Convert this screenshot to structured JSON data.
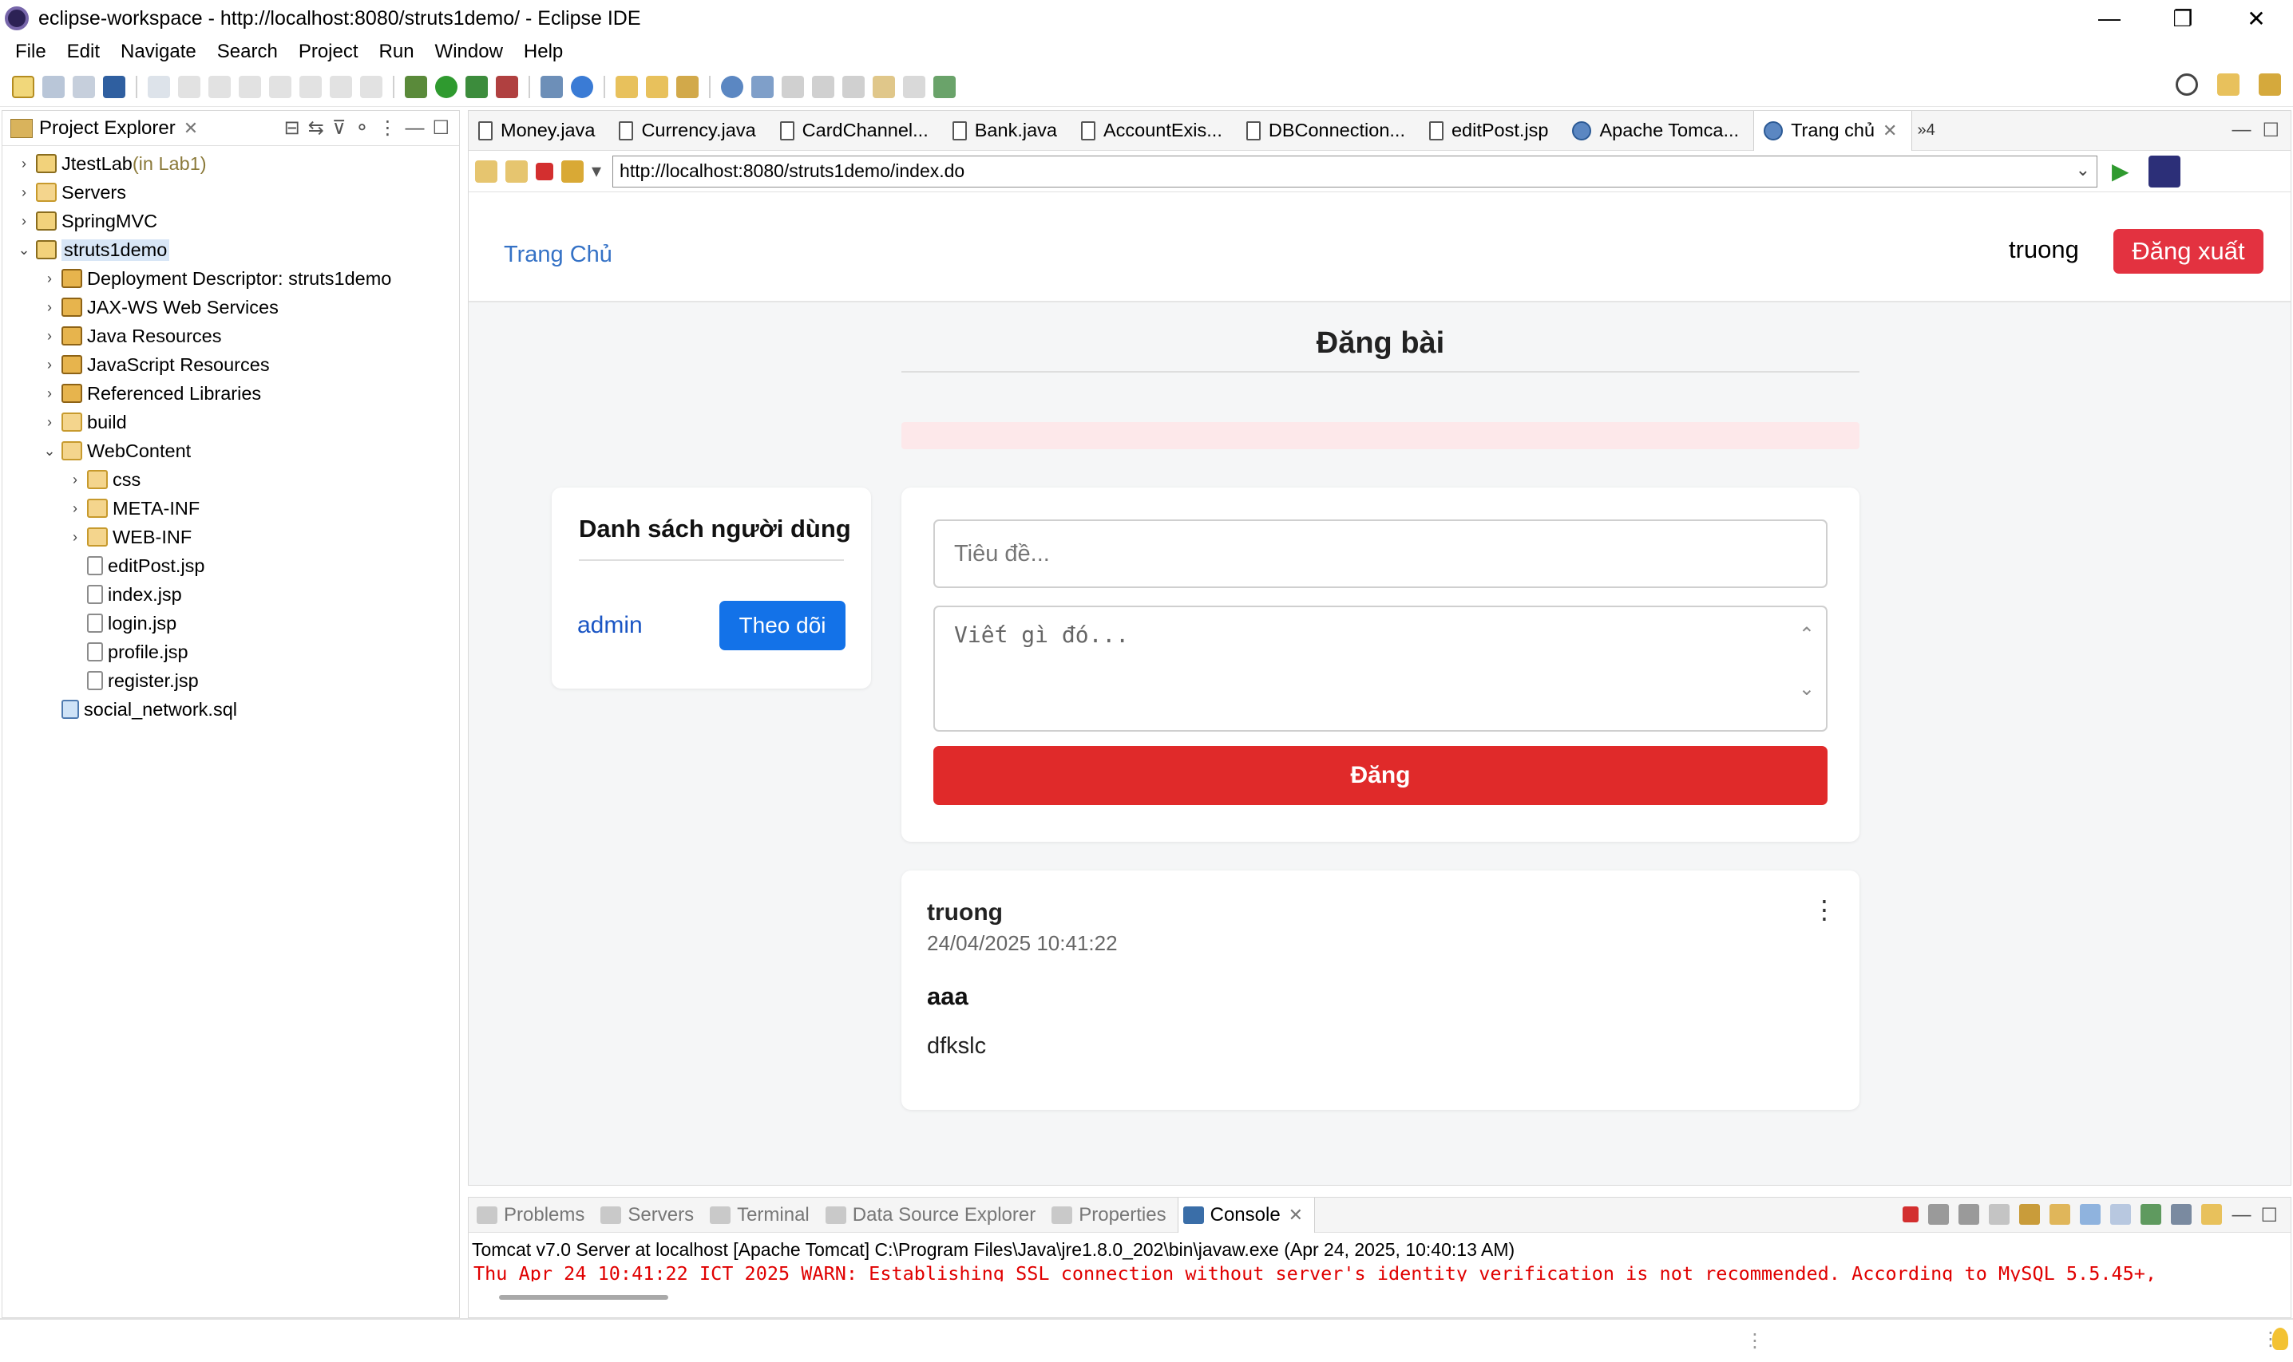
{
  "window": {
    "title": "eclipse-workspace - http://localhost:8080/struts1demo/ - Eclipse IDE",
    "minimize": "—",
    "restore": "❐",
    "close": "✕"
  },
  "menu": [
    "File",
    "Edit",
    "Navigate",
    "Search",
    "Project",
    "Run",
    "Window",
    "Help"
  ],
  "explorer": {
    "title": "Project Explorer",
    "close": "✕",
    "tree": [
      {
        "label": "JtestLab",
        "suffix": " (in Lab1)",
        "indent": 0,
        "twisty": "›",
        "icon": "project"
      },
      {
        "label": "Servers",
        "indent": 0,
        "twisty": "›",
        "icon": "folder"
      },
      {
        "label": "SpringMVC",
        "indent": 0,
        "twisty": "›",
        "icon": "project"
      },
      {
        "label": "struts1demo",
        "indent": 0,
        "twisty": "⌄",
        "icon": "project",
        "selected": true
      },
      {
        "label": "Deployment Descriptor: struts1demo",
        "indent": 1,
        "twisty": "›",
        "icon": "pkg"
      },
      {
        "label": "JAX-WS Web Services",
        "indent": 1,
        "twisty": "›",
        "icon": "pkg"
      },
      {
        "label": "Java Resources",
        "indent": 1,
        "twisty": "›",
        "icon": "pkg"
      },
      {
        "label": "JavaScript Resources",
        "indent": 1,
        "twisty": "›",
        "icon": "pkg"
      },
      {
        "label": "Referenced Libraries",
        "indent": 1,
        "twisty": "›",
        "icon": "pkg"
      },
      {
        "label": "build",
        "indent": 1,
        "twisty": "›",
        "icon": "folder"
      },
      {
        "label": "WebContent",
        "indent": 1,
        "twisty": "⌄",
        "icon": "folder"
      },
      {
        "label": "css",
        "indent": 2,
        "twisty": "›",
        "icon": "folder"
      },
      {
        "label": "META-INF",
        "indent": 2,
        "twisty": "›",
        "icon": "folder"
      },
      {
        "label": "WEB-INF",
        "indent": 2,
        "twisty": "›",
        "icon": "folder"
      },
      {
        "label": "editPost.jsp",
        "indent": 2,
        "twisty": "",
        "icon": "jsp"
      },
      {
        "label": "index.jsp",
        "indent": 2,
        "twisty": "",
        "icon": "jsp"
      },
      {
        "label": "login.jsp",
        "indent": 2,
        "twisty": "",
        "icon": "jsp"
      },
      {
        "label": "profile.jsp",
        "indent": 2,
        "twisty": "",
        "icon": "jsp"
      },
      {
        "label": "register.jsp",
        "indent": 2,
        "twisty": "",
        "icon": "jsp"
      },
      {
        "label": "social_network.sql",
        "indent": 1,
        "twisty": "",
        "icon": "sql"
      }
    ]
  },
  "editor": {
    "tabs": [
      {
        "label": "Money.java",
        "icon": "java"
      },
      {
        "label": "Currency.java",
        "icon": "java"
      },
      {
        "label": "CardChannel...",
        "icon": "java"
      },
      {
        "label": "Bank.java",
        "icon": "java"
      },
      {
        "label": "AccountExis...",
        "icon": "java"
      },
      {
        "label": "DBConnection...",
        "icon": "java"
      },
      {
        "label": "editPost.jsp",
        "icon": "jsp"
      },
      {
        "label": "Apache Tomca...",
        "icon": "globe"
      },
      {
        "label": "Trang chủ",
        "icon": "globe",
        "active": true
      }
    ],
    "overflow": "»4",
    "tab_close": "✕",
    "url": "http://localhost:8080/struts1demo/index.do"
  },
  "site": {
    "nav_home": "Trang Chủ",
    "current_user": "truong",
    "logout": "Đăng xuất",
    "heading": "Đăng bài",
    "users_title": "Danh sách người dùng",
    "users": [
      {
        "name": "admin",
        "action": "Theo dõi"
      }
    ],
    "form": {
      "title_placeholder": "Tiêu đề...",
      "content_placeholder": "Viết gì đó...",
      "submit": "Đăng"
    },
    "posts": [
      {
        "author": "truong",
        "time": "24/04/2025 10:41:22",
        "title": "aaa",
        "body": "dfkslc",
        "menu": "⋮"
      }
    ]
  },
  "console": {
    "tabs": [
      {
        "label": "Problems"
      },
      {
        "label": "Servers"
      },
      {
        "label": "Terminal"
      },
      {
        "label": "Data Source Explorer"
      },
      {
        "label": "Properties"
      },
      {
        "label": "Console",
        "active": true
      }
    ],
    "header": "Tomcat v7.0 Server at localhost [Apache Tomcat] C:\\Program Files\\Java\\jre1.8.0_202\\bin\\javaw.exe  (Apr 24, 2025, 10:40:13 AM)",
    "line": "Thu Apr 24 10:41:22 ICT 2025 WARN: Establishing SSL connection without server's identity verification is not recommended. According to MySQL 5.5.45+,"
  },
  "colors": {
    "accent_blue": "#1372e8",
    "danger_red": "#e02a2a",
    "logout_red": "#e33240",
    "link_blue": "#3572c6",
    "console_error": "#e00000"
  }
}
